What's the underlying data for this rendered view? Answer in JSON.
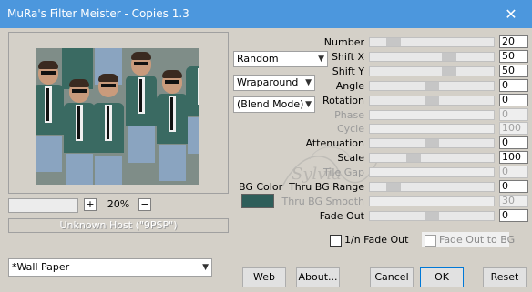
{
  "window": {
    "title": "MuRa's Filter Meister - Copies 1.3",
    "close_glyph": "✕"
  },
  "preview": {
    "zoom": "20%",
    "zoom_minus": "−",
    "zoom_plus": "+",
    "host": "Unknown Host (\"9PSP\")"
  },
  "dropdowns": {
    "mode": "Random",
    "edge": "Wraparound",
    "blend": "(Blend Mode)",
    "preset": "*Wall Paper"
  },
  "bg_color": {
    "label": "BG Color",
    "value": "#2e5e5a"
  },
  "watermark": "Sylvia",
  "params": [
    {
      "label": "Number",
      "value": "20",
      "enabled": true,
      "level": 0.15
    },
    {
      "label": "Shift X",
      "value": "50",
      "enabled": true,
      "level": 0.66
    },
    {
      "label": "Shift Y",
      "value": "50",
      "enabled": true,
      "level": 0.66
    },
    {
      "label": "Angle",
      "value": "0",
      "enabled": true,
      "level": 0.5
    },
    {
      "label": "Rotation",
      "value": "0",
      "enabled": true,
      "level": 0.5
    },
    {
      "label": "Phase",
      "value": "0",
      "enabled": false,
      "level": 0
    },
    {
      "label": "Cycle",
      "value": "100",
      "enabled": false,
      "level": 0
    },
    {
      "label": "Attenuation",
      "value": "0",
      "enabled": true,
      "level": 0.5
    },
    {
      "label": "Scale",
      "value": "100",
      "enabled": true,
      "level": 0.33
    },
    {
      "label": "Tile Gap",
      "value": "0",
      "enabled": false,
      "level": 0
    },
    {
      "label": "Thru BG Range",
      "value": "0",
      "enabled": true,
      "level": 0.15
    },
    {
      "label": "Thru BG Smooth",
      "value": "30",
      "enabled": false,
      "level": 0
    },
    {
      "label": "Fade Out",
      "value": "0",
      "enabled": true,
      "level": 0.5
    }
  ],
  "checkboxes": {
    "fade_out_n": "1/n Fade Out",
    "fade_out_bg": "Fade Out to BG"
  },
  "buttons": {
    "web": "Web",
    "about": "About...",
    "cancel": "Cancel",
    "ok": "OK",
    "reset": "Reset"
  }
}
